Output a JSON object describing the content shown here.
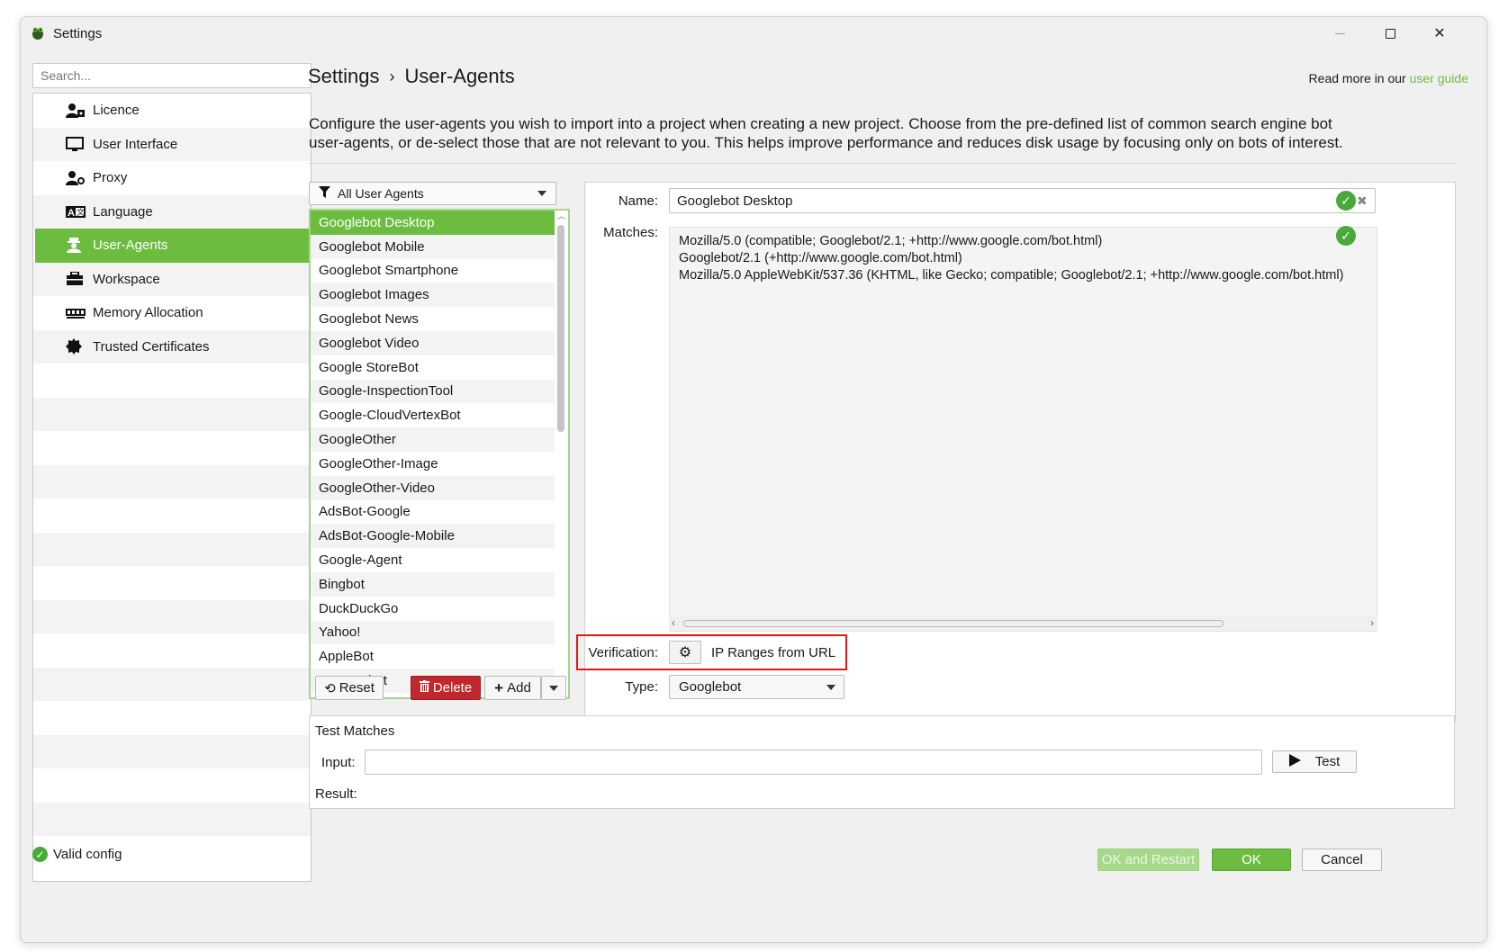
{
  "window": {
    "title": "Settings",
    "icons": {
      "app": "frog-app-icon",
      "minimize": "minimize-icon",
      "maximize": "maximize-icon",
      "close": "close-icon"
    }
  },
  "sidebar": {
    "search_placeholder": "Search...",
    "items": [
      {
        "label": "Licence",
        "icon": "user-key-icon",
        "glyph": "👤"
      },
      {
        "label": "User Interface",
        "icon": "monitor-icon",
        "glyph": "🖵"
      },
      {
        "label": "Proxy",
        "icon": "user-globe-icon",
        "glyph": "👤"
      },
      {
        "label": "Language",
        "icon": "language-icon",
        "glyph": "A"
      },
      {
        "label": "User-Agents",
        "icon": "user-agent-icon",
        "glyph": "♜",
        "active": true
      },
      {
        "label": "Workspace",
        "icon": "toolbox-icon",
        "glyph": "🧰"
      },
      {
        "label": "Memory Allocation",
        "icon": "memory-chip-icon",
        "glyph": "▦"
      },
      {
        "label": "Trusted Certificates",
        "icon": "certificate-icon",
        "glyph": "✹"
      }
    ]
  },
  "status": {
    "text": "Valid config",
    "color": "#49a93a"
  },
  "header": {
    "crumb_root": "Settings",
    "crumb_sep": "›",
    "crumb_current": "User-Agents",
    "readmore_prefix": "Read more in our",
    "readmore_link": "user guide",
    "description": "Configure the user-agents you wish to import into a project when creating a new project. Choose from the pre-defined list of common search engine bot user-agents, or de-select those that are not relevant to you. This helps improve performance and reduces disk usage by focusing only on bots of interest."
  },
  "filter": {
    "selected": "All User Agents"
  },
  "agents": [
    "Googlebot Desktop",
    "Googlebot Mobile",
    "Googlebot Smartphone",
    "Googlebot Images",
    "Googlebot News",
    "Googlebot Video",
    "Google StoreBot",
    "Google-InspectionTool",
    "Google-CloudVertexBot",
    "GoogleOther",
    "GoogleOther-Image",
    "GoogleOther-Video",
    "AdsBot-Google",
    "AdsBot-Google-Mobile",
    "Google-Agent",
    "Bingbot",
    "DuckDuckGo",
    "Yahoo!",
    "AppleBot",
    "Amazonbot"
  ],
  "list_buttons": {
    "reset": "Reset",
    "delete": "Delete",
    "add": "Add"
  },
  "detail": {
    "name_label": "Name:",
    "name_value": "Googlebot Desktop",
    "matches_label": "Matches:",
    "matches": [
      "Mozilla/5.0 (compatible; Googlebot/2.1; +http://www.google.com/bot.html)",
      "Googlebot/2.1 (+http://www.google.com/bot.html)",
      "Mozilla/5.0 AppleWebKit/537.36 (KHTML, like Gecko; compatible; Googlebot/2.1; +http://www.google.com/bot.html)"
    ],
    "verification_label": "Verification:",
    "verification_value": "IP Ranges from URL",
    "type_label": "Type:",
    "type_value": "Googlebot"
  },
  "test": {
    "title": "Test Matches",
    "input_label": "Input:",
    "input_value": "",
    "test_button": "Test",
    "result_label": "Result:"
  },
  "footer": {
    "ok_restart": "OK and Restart",
    "ok": "OK",
    "cancel": "Cancel"
  },
  "colors": {
    "accent": "#6cbd3f",
    "danger": "#c1272d",
    "highlight_border": "#e01818"
  }
}
